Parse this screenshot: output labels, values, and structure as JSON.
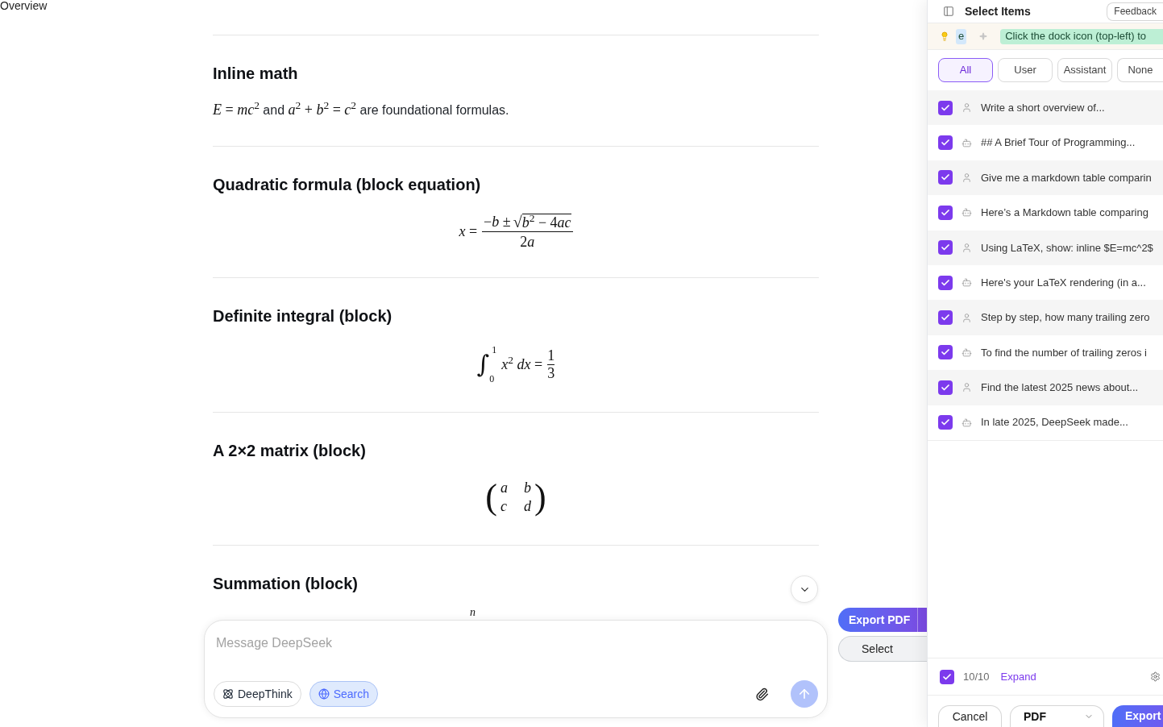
{
  "nav_label": "Overview",
  "sections": [
    {
      "title": "Inline math",
      "kind": "inline",
      "parts": [
        {
          "kind": "math",
          "text": "*E* = *mc*$^{2}$"
        },
        {
          "kind": "text",
          "text": " and "
        },
        {
          "kind": "math",
          "text": "*a*$^{2}$ + *b*$^{2}$ = *c*$^{2}$"
        },
        {
          "kind": "text",
          "text": " are foundational formulas."
        }
      ]
    },
    {
      "title": "Quadratic formula (block equation)",
      "kind": "fraction",
      "lhs": "*x* =",
      "numerator": "−*b* ±",
      "radical": "√",
      "radicand": [
        "*b*$^{2}$ − 4",
        "*ac*"
      ],
      "denominator": [
        "2",
        "*a*"
      ]
    },
    {
      "title": "Definite integral (block)",
      "kind": "integral",
      "symbol": "∫",
      "upper": "1",
      "lower": "0",
      "body": "*x*$^{2}$ *dx* =",
      "numerator": "1",
      "denominator": "3"
    },
    {
      "title": "A 2×2 matrix (block)",
      "kind": "matrix",
      "open": "(",
      "close": ")",
      "rows": [
        [
          "*a*",
          "*b*"
        ],
        [
          "*c*",
          "*d*"
        ]
      ]
    },
    {
      "title": "Summation (block)",
      "kind": "summation",
      "upper": "*n*"
    }
  ],
  "floating_actions": [
    {
      "label": "Export PDF",
      "kind": "primary"
    },
    {
      "label": "Select",
      "kind": "secondary"
    }
  ],
  "composer": {
    "placeholder": "Message DeepSeek",
    "toggles": [
      {
        "label": "DeepThink",
        "kind": "think",
        "on": false
      },
      {
        "label": "Search",
        "kind": "search",
        "on": true
      }
    ]
  },
  "panel": {
    "title": "Select Items",
    "feedback": "Feedback",
    "hints": [
      {
        "text": "e",
        "color": "#d3e8fb"
      },
      {
        "text": "Click the dock icon (top-left) to",
        "color": "#bdefd5"
      }
    ],
    "filters": [
      {
        "label": "All",
        "selected": true
      },
      {
        "label": "User",
        "selected": false
      },
      {
        "label": "Assistant",
        "selected": false
      },
      {
        "label": "None",
        "selected": false
      }
    ],
    "items": [
      {
        "kind": "user",
        "text": "Write a short overview of...",
        "checked": true
      },
      {
        "kind": "assistant",
        "text": "## A Brief Tour of Programming...",
        "checked": true
      },
      {
        "kind": "user",
        "text": "Give me a markdown table comparin",
        "checked": true
      },
      {
        "kind": "assistant",
        "text": "Here’s a Markdown table comparing",
        "checked": true
      },
      {
        "kind": "user",
        "text": "Using LaTeX, show: inline $E=mc^2$",
        "checked": true
      },
      {
        "kind": "assistant",
        "text": "Here's your LaTeX rendering (in a...",
        "checked": true
      },
      {
        "kind": "user",
        "text": "Step by step, how many trailing zero",
        "checked": true
      },
      {
        "kind": "assistant",
        "text": "To find the number of trailing zeros i",
        "checked": true
      },
      {
        "kind": "user",
        "text": "Find the latest 2025 news about...",
        "checked": true
      },
      {
        "kind": "assistant",
        "text": "In late 2025, DeepSeek made...",
        "checked": true
      }
    ],
    "select_all": {
      "checked": true,
      "count": "10/10",
      "link": "Expand"
    },
    "actions": {
      "cancel": "Cancel",
      "format": "PDF",
      "export": "Export"
    }
  }
}
